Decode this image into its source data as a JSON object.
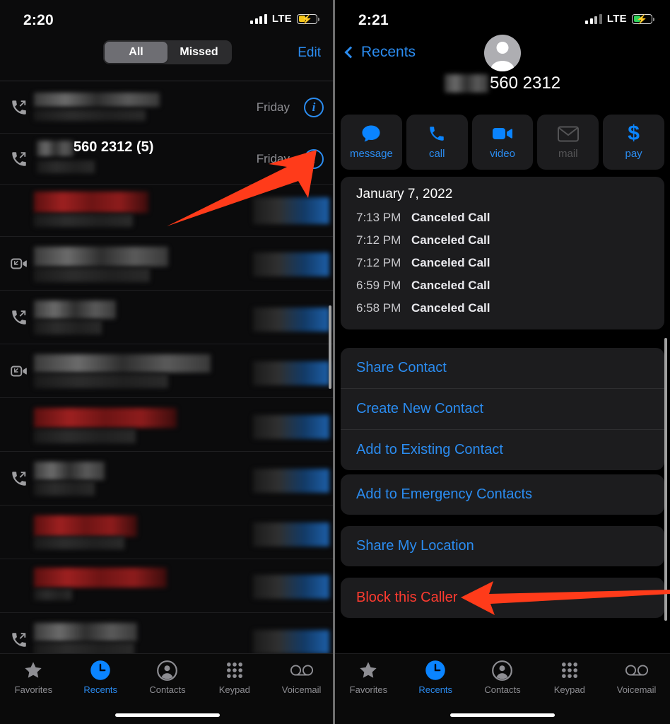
{
  "left_screen": {
    "status": {
      "time": "2:20",
      "carrier_tech": "LTE",
      "battery_color": "#f5c518",
      "battery_charging": true,
      "signal_bars": 4
    },
    "navbar": {
      "segments": [
        {
          "label": "All",
          "selected": true
        },
        {
          "label": "Missed",
          "selected": false
        }
      ],
      "edit_label": "Edit"
    },
    "call_rows": [
      {
        "direction_icon": "outgoing-call-icon",
        "name_visible": "",
        "redacted": true,
        "time_label": "Friday",
        "info": "i"
      },
      {
        "direction_icon": "outgoing-call-icon",
        "name_visible": "560 2312 (5)",
        "redacted": true,
        "time_label": "Friday",
        "info": "i"
      },
      {
        "direction_icon": "none",
        "name_visible": "",
        "redacted": true,
        "redact_color": "red",
        "time_label": "",
        "info": "i"
      },
      {
        "direction_icon": "facetime-video-icon",
        "name_visible": "",
        "redacted": true,
        "time_label": "",
        "info": "i"
      },
      {
        "direction_icon": "outgoing-call-icon",
        "name_visible": "",
        "redacted": true,
        "time_label": "",
        "info": "i"
      },
      {
        "direction_icon": "facetime-video-icon",
        "name_visible": "",
        "redacted": true,
        "time_label": "",
        "info": "i"
      },
      {
        "direction_icon": "none",
        "name_visible": "",
        "redacted": true,
        "redact_color": "red",
        "time_label": "",
        "info": "i"
      },
      {
        "direction_icon": "outgoing-call-icon",
        "name_visible": "",
        "redacted": true,
        "time_label": "",
        "info": "i"
      },
      {
        "direction_icon": "none",
        "name_visible": "",
        "redacted": true,
        "redact_color": "red",
        "time_label": "",
        "info": "i"
      },
      {
        "direction_icon": "none",
        "name_visible": "",
        "redacted": true,
        "redact_color": "red",
        "time_label": "",
        "info": "i"
      },
      {
        "direction_icon": "outgoing-call-icon",
        "name_visible": "",
        "redacted": true,
        "time_label": "",
        "info": "i"
      },
      {
        "direction_icon": "outgoing-call-icon",
        "name_visible": "",
        "redacted": true,
        "time_label": "",
        "info": "i"
      }
    ],
    "tabbar": [
      {
        "label": "Favorites",
        "icon": "star-icon",
        "active": false
      },
      {
        "label": "Recents",
        "icon": "clock-icon",
        "active": true
      },
      {
        "label": "Contacts",
        "icon": "person-circle-icon",
        "active": false
      },
      {
        "label": "Keypad",
        "icon": "keypad-grid-icon",
        "active": false
      },
      {
        "label": "Voicemail",
        "icon": "voicemail-icon",
        "active": false
      }
    ]
  },
  "right_screen": {
    "status": {
      "time": "2:21",
      "carrier_tech": "LTE",
      "battery_color": "#30d158",
      "battery_charging": true,
      "signal_bars": 3
    },
    "navbar": {
      "back_label": "Recents"
    },
    "contact": {
      "number_visible": "560 2312",
      "avatar_icon": "default-person-avatar"
    },
    "action_buttons": [
      {
        "label": "message",
        "icon": "message-bubble-icon",
        "enabled": true
      },
      {
        "label": "call",
        "icon": "phone-handset-icon",
        "enabled": true
      },
      {
        "label": "video",
        "icon": "video-camera-icon",
        "enabled": true
      },
      {
        "label": "mail",
        "icon": "envelope-icon",
        "enabled": false
      },
      {
        "label": "pay",
        "icon": "dollar-sign-icon",
        "enabled": true
      }
    ],
    "call_history": {
      "date": "January 7, 2022",
      "entries": [
        {
          "time": "7:13 PM",
          "type": "Canceled Call"
        },
        {
          "time": "7:12 PM",
          "type": "Canceled Call"
        },
        {
          "time": "7:12 PM",
          "type": "Canceled Call"
        },
        {
          "time": "6:59 PM",
          "type": "Canceled Call"
        },
        {
          "time": "6:58 PM",
          "type": "Canceled Call"
        }
      ]
    },
    "menu_groups": [
      {
        "items": [
          {
            "label": "Share Contact",
            "destructive": false
          },
          {
            "label": "Create New Contact",
            "destructive": false
          },
          {
            "label": "Add to Existing Contact",
            "destructive": false
          }
        ]
      },
      {
        "items": [
          {
            "label": "Add to Emergency Contacts",
            "destructive": false
          }
        ]
      },
      {
        "items": [
          {
            "label": "Share My Location",
            "destructive": false
          }
        ]
      },
      {
        "items": [
          {
            "label": "Block this Caller",
            "destructive": true
          }
        ]
      }
    ],
    "tabbar": [
      {
        "label": "Favorites",
        "icon": "star-icon",
        "active": false
      },
      {
        "label": "Recents",
        "icon": "clock-icon",
        "active": true
      },
      {
        "label": "Contacts",
        "icon": "person-circle-icon",
        "active": false
      },
      {
        "label": "Keypad",
        "icon": "keypad-grid-icon",
        "active": false
      },
      {
        "label": "Voicemail",
        "icon": "voicemail-icon",
        "active": false
      }
    ]
  },
  "annotations": {
    "accent_color": "#ff3b1a",
    "arrows": [
      {
        "name": "arrow-to-info-button",
        "points_to": "info button of 560 2312 row"
      },
      {
        "name": "arrow-to-block-this-caller",
        "points_to": "Block this Caller"
      }
    ]
  }
}
